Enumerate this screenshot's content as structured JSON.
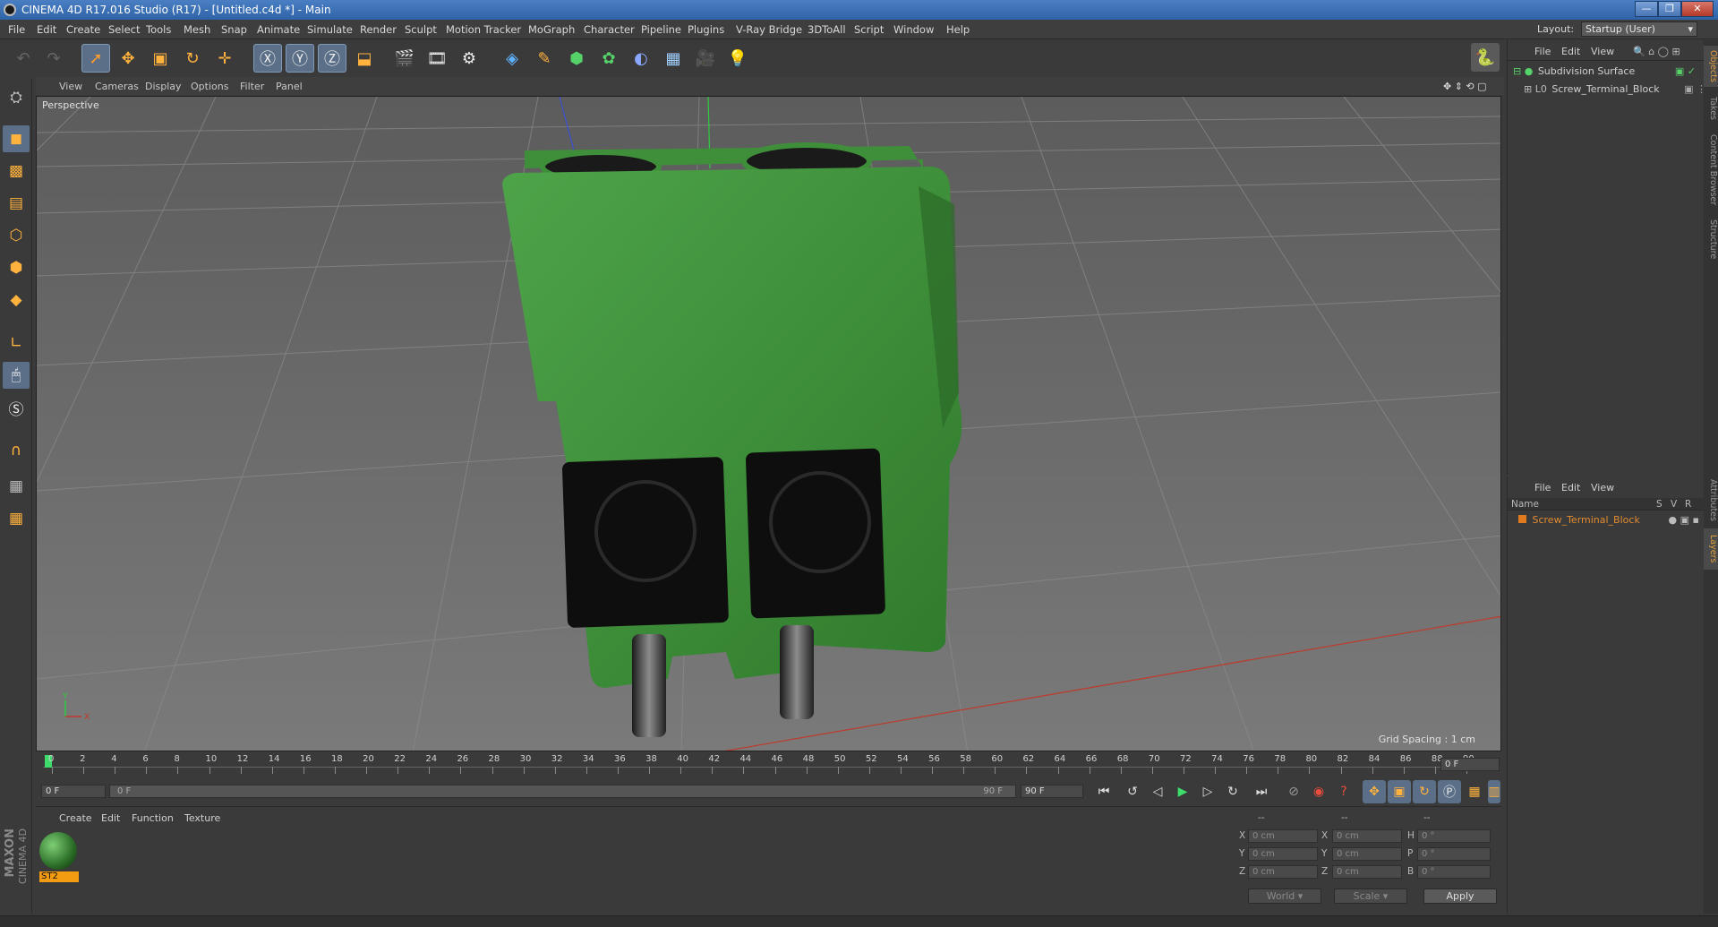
{
  "window": {
    "title": "CINEMA 4D R17.016 Studio (R17) - [Untitled.c4d *] - Main"
  },
  "menubar": {
    "items": [
      "File",
      "Edit",
      "Create",
      "Select",
      "Tools",
      "Mesh",
      "Snap",
      "Animate",
      "Simulate",
      "Render",
      "Sculpt",
      "Motion Tracker",
      "MoGraph",
      "Character",
      "Pipeline",
      "Plugins",
      "V-Ray Bridge",
      "3DToAll",
      "Script",
      "Window",
      "Help"
    ],
    "layout_label": "Layout:",
    "layout_value": "Startup (User)"
  },
  "viewport": {
    "menu": [
      "View",
      "Cameras",
      "Display",
      "Options",
      "Filter",
      "Panel"
    ],
    "label": "Perspective",
    "grid_spacing": "Grid Spacing : 1 cm"
  },
  "timeline": {
    "ticks": [
      "0",
      "2",
      "4",
      "6",
      "8",
      "10",
      "12",
      "14",
      "16",
      "18",
      "20",
      "22",
      "24",
      "26",
      "28",
      "30",
      "32",
      "34",
      "36",
      "38",
      "40",
      "42",
      "44",
      "46",
      "48",
      "50",
      "52",
      "54",
      "56",
      "58",
      "60",
      "62",
      "64",
      "66",
      "68",
      "70",
      "72",
      "74",
      "76",
      "78",
      "80",
      "82",
      "84",
      "86",
      "88",
      "90"
    ],
    "current_frame": "0 F",
    "start_field": "0 F",
    "range_start": "0 F",
    "range_end": "90 F",
    "end_field": "90 F"
  },
  "material_manager": {
    "menu": [
      "Create",
      "Edit",
      "Function",
      "Texture"
    ],
    "material_name": "ST2"
  },
  "coordinates": {
    "header": [
      "--",
      "--",
      "--"
    ],
    "rows": [
      {
        "a": "X",
        "av": "0 cm",
        "b": "X",
        "bv": "0 cm",
        "c": "H",
        "cv": "0 °"
      },
      {
        "a": "Y",
        "av": "0 cm",
        "b": "Y",
        "bv": "0 cm",
        "c": "P",
        "cv": "0 °"
      },
      {
        "a": "Z",
        "av": "0 cm",
        "b": "Z",
        "bv": "0 cm",
        "c": "B",
        "cv": "0 °"
      }
    ],
    "world_select": "World",
    "scale_select": "Scale",
    "apply_label": "Apply"
  },
  "object_manager": {
    "menu": [
      "File",
      "Edit",
      "View"
    ],
    "objects": [
      "Subdivision Surface",
      "Screw_Terminal_Block"
    ]
  },
  "layer_manager": {
    "menu": [
      "File",
      "Edit",
      "View"
    ],
    "columns": [
      "Name",
      "S",
      "V",
      "R"
    ],
    "layers": [
      "Screw_Terminal_Block"
    ]
  },
  "right_tabs": [
    "Objects",
    "Takes",
    "Content Browser",
    "Structure",
    "Attributes",
    "Layers"
  ],
  "branding": {
    "vendor": "MAXON",
    "product": "CINEMA 4D"
  },
  "colors": {
    "accent_blue": "#4a7fc4",
    "model_green": "#3f8f3a",
    "layer_orange": "#e07a1f",
    "x_axis": "#c0392b",
    "y_axis": "#2ecc40"
  }
}
